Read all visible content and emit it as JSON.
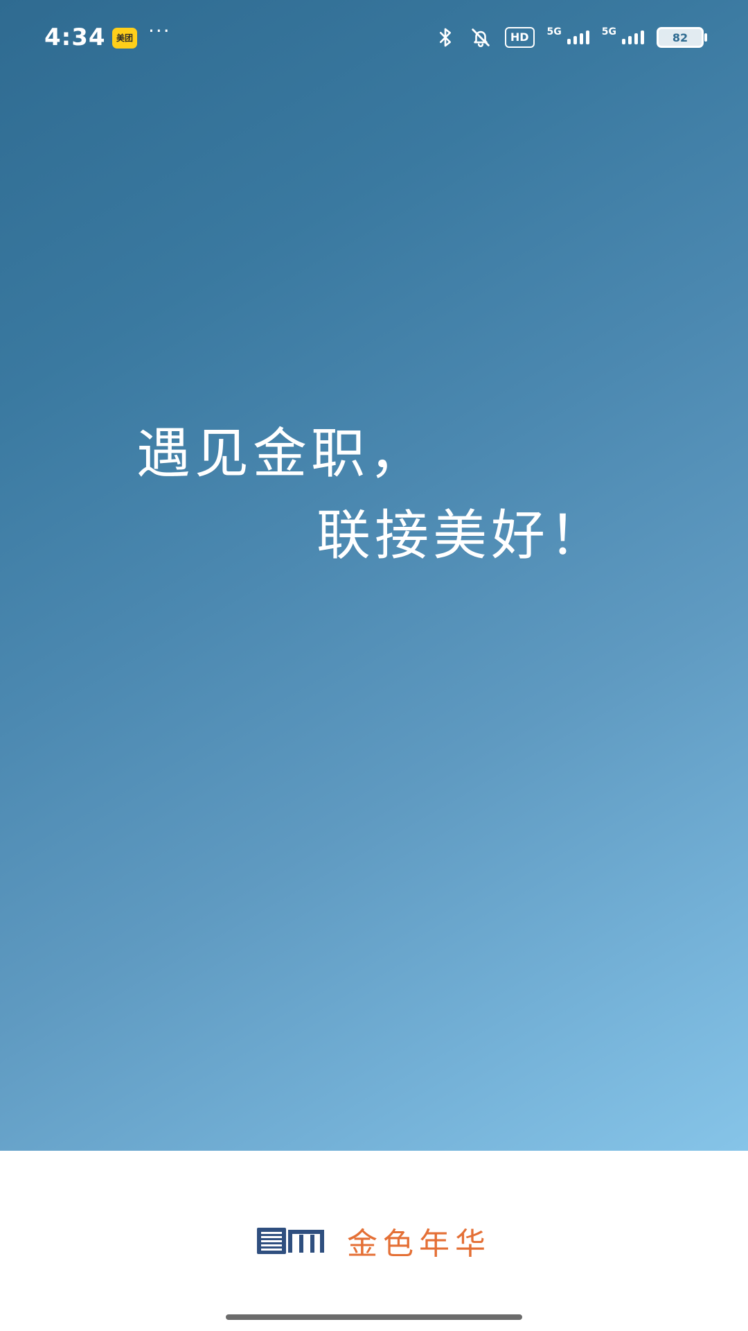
{
  "status_bar": {
    "time": "4:34",
    "app_badge_text": "美团",
    "more_text": "···",
    "network_label_1": "5G",
    "network_label_2": "5G",
    "hd_badge": "HD",
    "battery_level": "82"
  },
  "hero": {
    "slogan_line_1": "遇见金职，",
    "slogan_line_2": "联接美好！"
  },
  "brand": {
    "name": "金色年华",
    "accent_color": "#e46f35",
    "logo_color": "#2f4f7f"
  },
  "icons": {
    "bluetooth": "bluetooth-icon",
    "mute": "notifications-muted-icon",
    "signal": "signal-bars-icon",
    "battery": "battery-icon"
  }
}
